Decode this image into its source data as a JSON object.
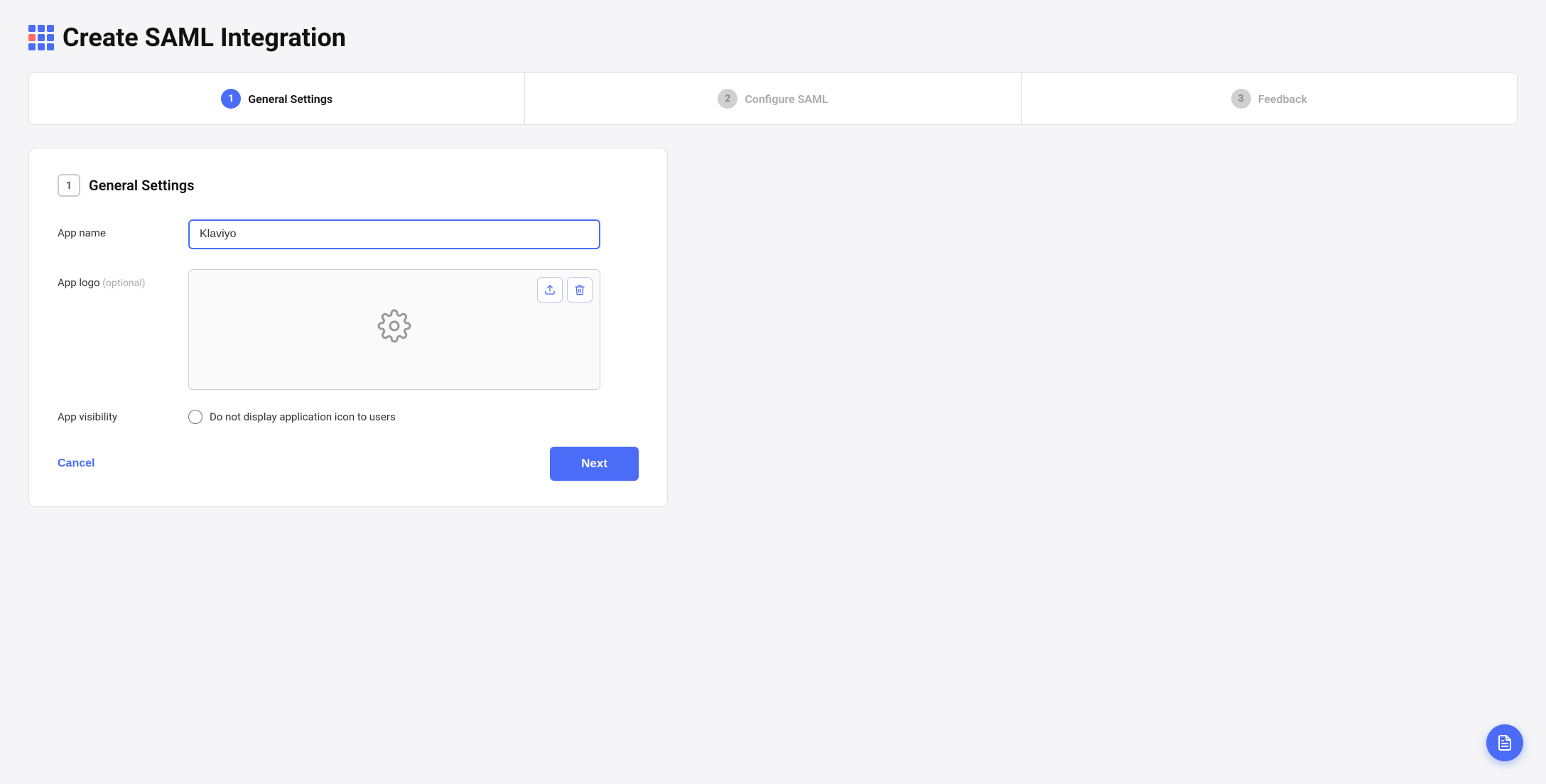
{
  "page": {
    "title": "Create SAML Integration",
    "grid_icon_label": "app-grid-icon"
  },
  "stepper": {
    "steps": [
      {
        "number": "1",
        "label": "General Settings",
        "state": "active"
      },
      {
        "number": "2",
        "label": "Configure SAML",
        "state": "inactive"
      },
      {
        "number": "3",
        "label": "Feedback",
        "state": "inactive"
      }
    ]
  },
  "form": {
    "section_number": "1",
    "section_title": "General Settings",
    "app_name_label": "App name",
    "app_name_value": "Klaviyo",
    "app_name_placeholder": "",
    "app_logo_label": "App logo",
    "app_logo_optional": "(optional)",
    "app_visibility_label": "App visibility",
    "app_visibility_option": "Do not display application icon to users",
    "cancel_label": "Cancel",
    "next_label": "Next"
  },
  "floating_button": {
    "icon": "📋"
  }
}
